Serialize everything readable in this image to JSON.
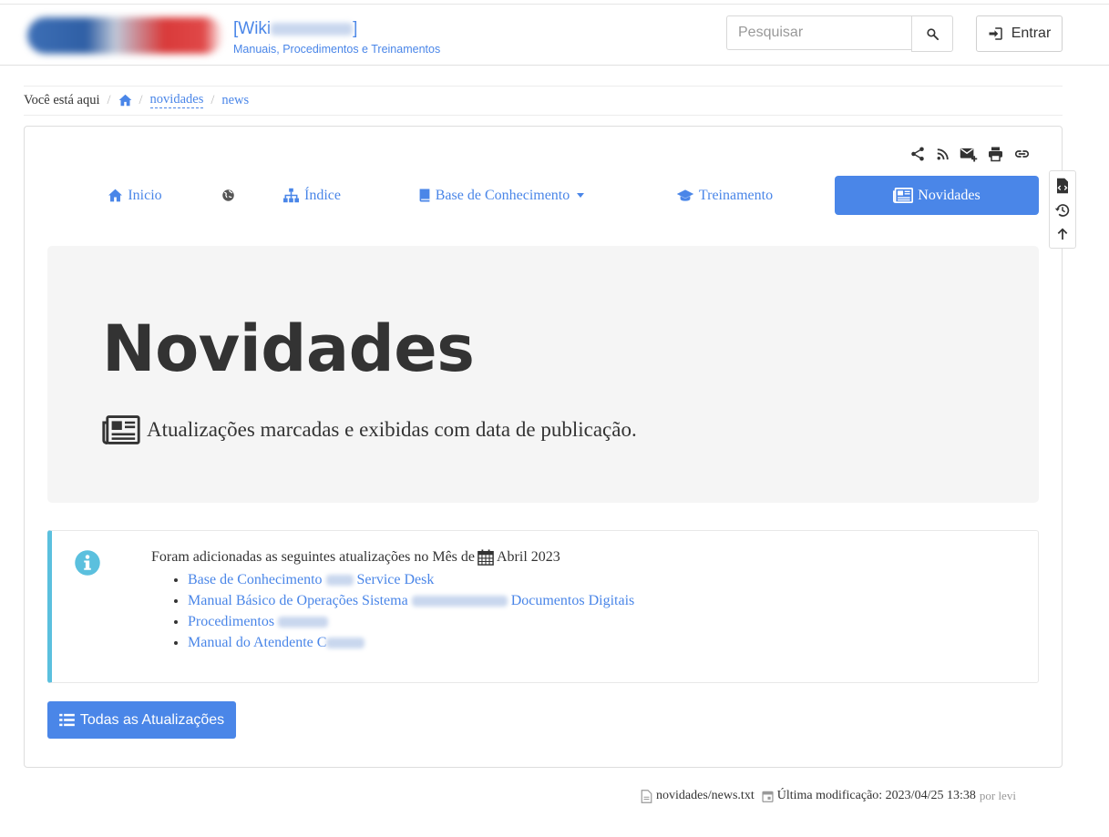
{
  "header": {
    "title": "[Wiki",
    "title_suffix": "]",
    "subtitle": "Manuais, Procedimentos e Treinamentos",
    "search_placeholder": "Pesquisar",
    "login_label": "Entrar"
  },
  "breadcrumb": {
    "intro": "Você está aqui",
    "items": [
      "novidades",
      "news"
    ]
  },
  "nav": {
    "items": [
      {
        "label": "Inicio",
        "icon": "home-icon"
      },
      {
        "label": "",
        "icon": "globe-icon"
      },
      {
        "label": "Índice",
        "icon": "sitemap-icon"
      },
      {
        "label": "Base de Conhecimento",
        "icon": "book-icon",
        "dropdown": true
      },
      {
        "label": "Treinamento",
        "icon": "graduation-cap-icon"
      },
      {
        "label": "Novidades",
        "icon": "newspaper-icon",
        "active": true
      }
    ]
  },
  "page_tools": [
    "share-icon",
    "rss-icon",
    "mail-add-icon",
    "print-icon",
    "link-icon"
  ],
  "side_tools": [
    "source-file-icon",
    "history-icon",
    "back-to-top-icon"
  ],
  "jumbotron": {
    "title": "Novidades",
    "lead": "Atualizações marcadas e exibidas com data de publicação."
  },
  "info": {
    "intro": "Foram adicionadas as seguintes atualizações no Mês de",
    "month": "Abril 2023",
    "links": [
      {
        "pre": "Base de Conhecimento",
        "post": "Service Desk"
      },
      {
        "pre": "Manual Básico de Operações Sistema",
        "post": "Documentos Digitais"
      },
      {
        "pre": "Procedimentos",
        "post": ""
      },
      {
        "pre": "Manual do Atendente C",
        "post": ""
      }
    ]
  },
  "all_updates_label": "Todas as Atualizações",
  "footer": {
    "file": "novidades/news.txt",
    "last_modified": "Última modificação: 2023/04/25 13:38",
    "by": "por levi"
  },
  "colors": {
    "accent": "#4a86e8",
    "info_border": "#5bc0de",
    "jumbotron_bg": "#f5f5f5"
  }
}
